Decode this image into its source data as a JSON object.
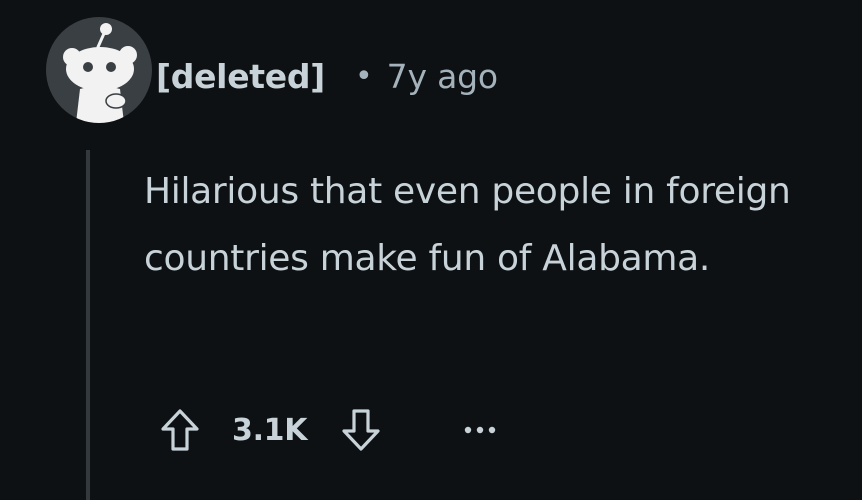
{
  "comment": {
    "author": "[deleted]",
    "separator": "•",
    "time": "7y ago",
    "text": "Hilarious that even people in foreign countries make fun of Alabama.",
    "score": "3.1K"
  },
  "icons": {
    "avatar": "snoo-avatar-icon",
    "upvote": "upvote-arrow-icon",
    "downvote": "downvote-arrow-icon",
    "more": "more-options-icon"
  },
  "colors": {
    "background": "#0e1113",
    "text": "#c8d3d9",
    "muted": "#a3b2bb",
    "thread_line": "#33393d",
    "avatar_bg": "#3a3f43"
  }
}
